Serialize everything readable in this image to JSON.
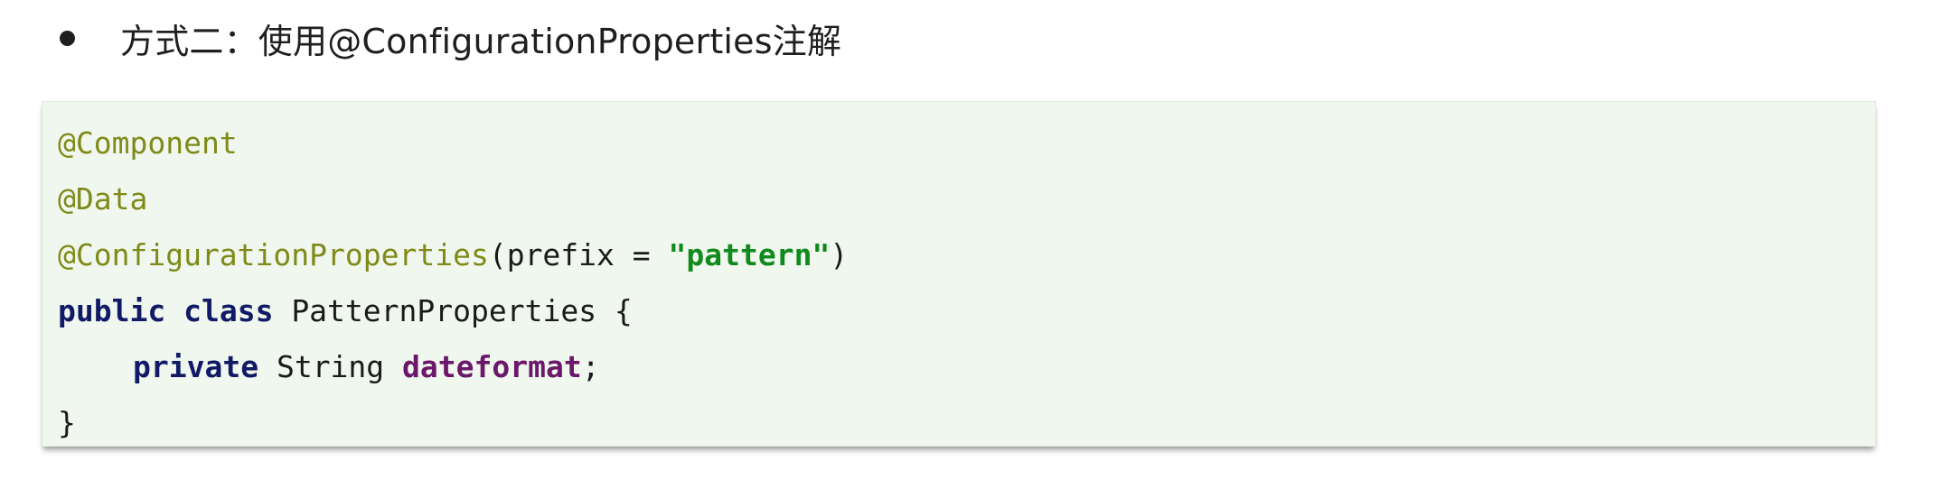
{
  "heading": {
    "text": "方式二：使用@ConfigurationProperties注解"
  },
  "code": {
    "line1": {
      "annotation": "@Component"
    },
    "line2": {
      "annotation": "@Data"
    },
    "line3": {
      "annotation": "@ConfigurationProperties",
      "open": "(prefix = ",
      "string": "\"pattern\"",
      "close": ")"
    },
    "line4": {
      "kw1": "public",
      "kw2": "class",
      "name": "PatternProperties {"
    },
    "line5": {
      "kw": "private",
      "type": "String",
      "field": "dateformat",
      "end": ";"
    },
    "line6": {
      "brace": "}"
    }
  },
  "colors": {
    "annotation": "#7f8a18",
    "keyword": "#101a66",
    "string": "#118a1c",
    "field": "#6b176a",
    "code_background": "#f0f7ee"
  }
}
